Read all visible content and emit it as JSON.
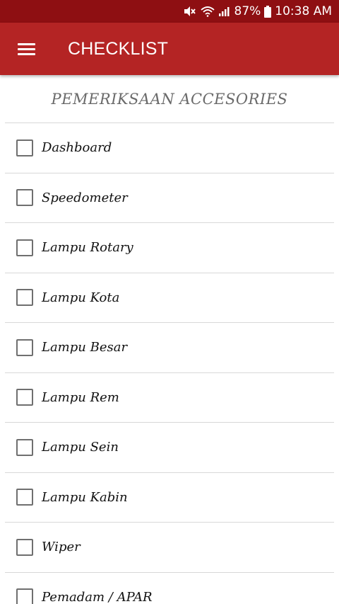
{
  "status_bar": {
    "battery": "87%",
    "time": "10:38 AM",
    "icons": [
      "mute-vibrate-icon",
      "wifi-icon",
      "signal-icon",
      "battery-icon"
    ]
  },
  "app_bar": {
    "menu_icon": "hamburger-menu-icon",
    "title": "CHECKLIST"
  },
  "section": {
    "title": "PEMERIKSAAN ACCESORIES"
  },
  "checklist": {
    "items": [
      {
        "label": "Dashboard",
        "checked": false
      },
      {
        "label": "Speedometer",
        "checked": false
      },
      {
        "label": "Lampu Rotary",
        "checked": false
      },
      {
        "label": "Lampu Kota",
        "checked": false
      },
      {
        "label": "Lampu Besar",
        "checked": false
      },
      {
        "label": "Lampu Rem",
        "checked": false
      },
      {
        "label": "Lampu Sein",
        "checked": false
      },
      {
        "label": "Lampu Kabin",
        "checked": false
      },
      {
        "label": "Wiper",
        "checked": false
      },
      {
        "label": "Pemadam / APAR",
        "checked": false
      }
    ]
  },
  "colors": {
    "status_bar": "#8e0f12",
    "app_bar": "#b42424",
    "divider": "#d8d8d8"
  }
}
